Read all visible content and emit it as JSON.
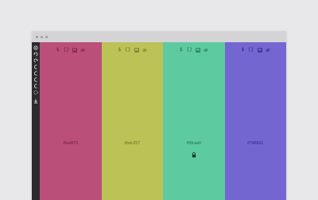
{
  "window": {
    "titlebar_dots": 3
  },
  "sidebar": {
    "tools": [
      {
        "icon": "settings-icon"
      },
      {
        "icon": "undo-icon"
      },
      {
        "icon": "redo-icon"
      },
      {
        "icon": "arc-icon"
      },
      {
        "icon": "arc-icon"
      },
      {
        "icon": "arc-icon"
      },
      {
        "icon": "arc-icon"
      },
      {
        "icon": "dotted-circle-icon"
      },
      {
        "icon": "download-icon"
      }
    ]
  },
  "palette": {
    "tool_icons": {
      "dollar": "$",
      "braces": "{}"
    },
    "colors": [
      {
        "hex": "#ba4f79",
        "label": "#ba4f79",
        "text_color": "#6a1e3e",
        "locked": false
      },
      {
        "hex": "#bdc257",
        "label": "#bdc257",
        "text_color": "#6a6c22",
        "locked": false
      },
      {
        "hex": "#5dcaa0",
        "label": "#5fcaa0",
        "text_color": "#1f6a4d",
        "locked": true
      },
      {
        "hex": "#7466d1",
        "label": "#7466d1",
        "text_color": "#2d2378",
        "locked": false
      }
    ]
  }
}
